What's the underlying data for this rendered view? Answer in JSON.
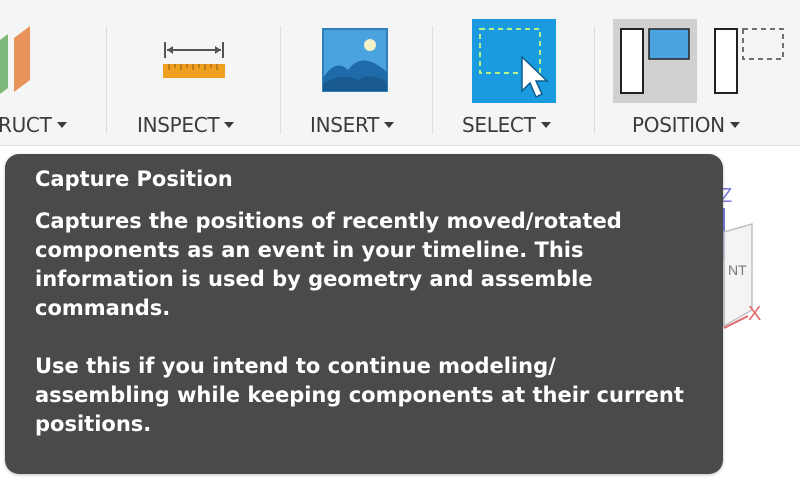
{
  "toolbar": {
    "groups": [
      {
        "label": "RUCT",
        "icon": "construct-planes-icon"
      },
      {
        "label": "INSPECT",
        "icon": "ruler-measure-icon"
      },
      {
        "label": "INSERT",
        "icon": "image-landscape-icon"
      },
      {
        "label": "SELECT",
        "icon": "select-window-cursor-icon"
      },
      {
        "label": "POSITION",
        "icon": "capture-position-icon"
      }
    ],
    "colors": {
      "select_blue": "#1a9be0",
      "insert_blue": "#4aa3df",
      "ruler_orange": "#f0a020"
    }
  },
  "tooltip": {
    "title": "Capture Position",
    "paragraph1": "Captures the positions of recently moved/rotated components as an event in your timeline. This information is used by geometry and assemble commands.",
    "paragraph2": "Use this if you intend to continue modeling/ assembling while keeping components at their current positions."
  },
  "viewcube": {
    "axis_z": "Z",
    "axis_x": "X",
    "face_label": "NT"
  }
}
